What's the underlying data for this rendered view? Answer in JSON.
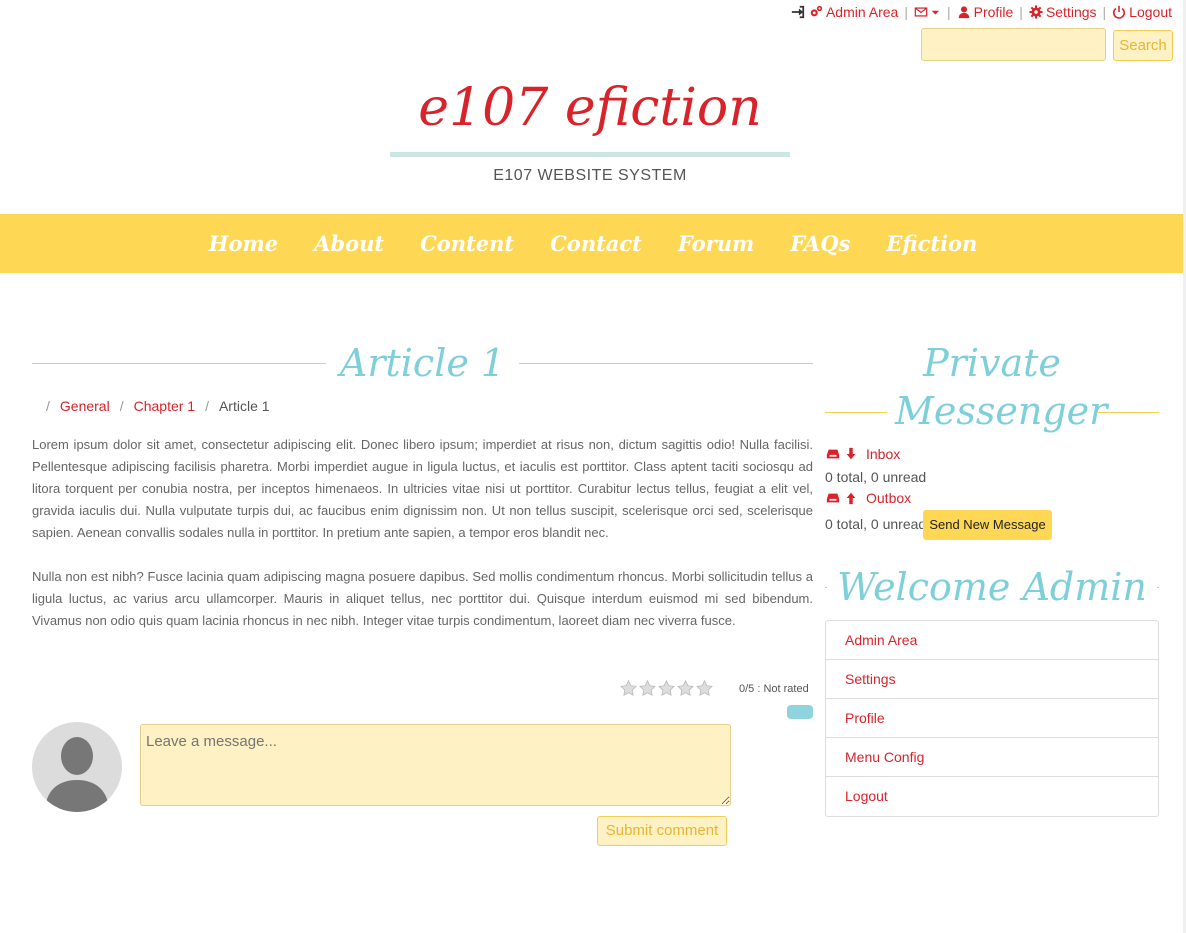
{
  "topbar": {
    "admin_area": "Admin Area",
    "profile": "Profile",
    "settings": "Settings",
    "logout": "Logout"
  },
  "search": {
    "button": "Search",
    "placeholder": ""
  },
  "header": {
    "title": "e107 efiction",
    "tagline": "E107 WEBSITE SYSTEM"
  },
  "nav": {
    "items": [
      "Home",
      "About",
      "Content",
      "Contact",
      "Forum",
      "FAQs",
      "Efiction"
    ]
  },
  "article": {
    "title": "Article 1",
    "breadcrumb": [
      "General",
      "Chapter 1",
      "Article 1"
    ],
    "paragraphs": [
      "Lorem ipsum dolor sit amet, consectetur adipiscing elit. Donec libero ipsum; imperdiet at risus non, dictum sagittis odio! Nulla facilisi. Pellentesque adipiscing facilisis pharetra. Morbi imperdiet augue in ligula luctus, et iaculis est porttitor. Class aptent taciti sociosqu ad litora torquent per conubia nostra, per inceptos himenaeos. In ultricies vitae nisi ut porttitor. Curabitur lectus tellus, feugiat a elit vel, gravida iaculis dui. Nulla vulputate turpis dui, ac faucibus enim dignissim non. Ut non tellus suscipit, scelerisque orci sed, scelerisque sapien. Aenean convallis sodales nulla in porttitor. In pretium ante sapien, a tempor eros blandit nec.",
      "Nulla non est nibh? Fusce lacinia quam adipiscing magna posuere dapibus. Sed mollis condimentum rhoncus. Morbi sollicitudin tellus a ligula luctus, ac varius arcu ullamcorper. Mauris in aliquet tellus, nec porttitor dui. Quisque interdum euismod mi sed bibendum. Vivamus non odio quis quam lacinia rhoncus in nec nibh. Integer vitae turpis condimentum, laoreet diam nec viverra fusce."
    ],
    "rating": {
      "stars": 5,
      "value": 0,
      "text": "0/5 : Not rated"
    }
  },
  "comment": {
    "placeholder": "Leave a message...",
    "submit": "Submit comment"
  },
  "private_messenger": {
    "title": "Private Messenger",
    "inbox_label": "Inbox",
    "inbox_count": "0 total, 0 unread",
    "outbox_label": "Outbox",
    "outbox_count": "0 total, 0 unread",
    "send_button": "Send New Message"
  },
  "welcome": {
    "title": "Welcome Admin",
    "menu": [
      "Admin Area",
      "Settings",
      "Profile",
      "Menu Config",
      "Logout"
    ]
  },
  "colors": {
    "accent_red": "#d9232b",
    "nav_yellow": "#fed854",
    "heading_teal": "#7dcfd9",
    "input_cream": "#fef1c4"
  }
}
